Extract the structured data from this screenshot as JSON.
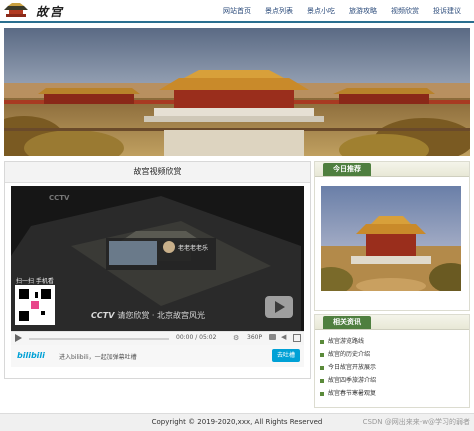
{
  "header": {
    "site_title": "故宫",
    "nav": [
      "网站首页",
      "景点列表",
      "景点小吃",
      "旅游攻略",
      "视频欣赏",
      "投诉建议"
    ]
  },
  "video_section": {
    "title": "故宫视频欣赏",
    "player": {
      "channel_mark": "CCTV",
      "qr_caption": "扫一扫 手机看",
      "uploader_name": "老老老老乐",
      "caption_cctv": "CCTV",
      "caption_text": "请您欣赏 · 北京故宫风光",
      "time": "00:00 / 05:02",
      "quality": "360P"
    },
    "bili": {
      "logo": "bilibili",
      "prompt": "进入bilibili，一起加弹幕吐槽",
      "button": "去吐槽"
    }
  },
  "sidebar": {
    "recommend_title": "今日推荐",
    "related_title": "相关资讯",
    "links": [
      "故宫游览路线",
      "故宫的历史介绍",
      "今日故宫开放展示",
      "故宫四季旅游介绍",
      "故宫春节寒暑观复"
    ]
  },
  "footer": {
    "copyright": "Copyright © 2019-2020,xxx, All Rights Reserved",
    "watermark": "CSDN @网出来来-w@学习的弱者"
  },
  "colors": {
    "accent": "#2b6f8f",
    "sidebar_tab": "#4f7f3f",
    "nav_text": "#2a4a7a",
    "bili_button": "#00a1d6"
  }
}
